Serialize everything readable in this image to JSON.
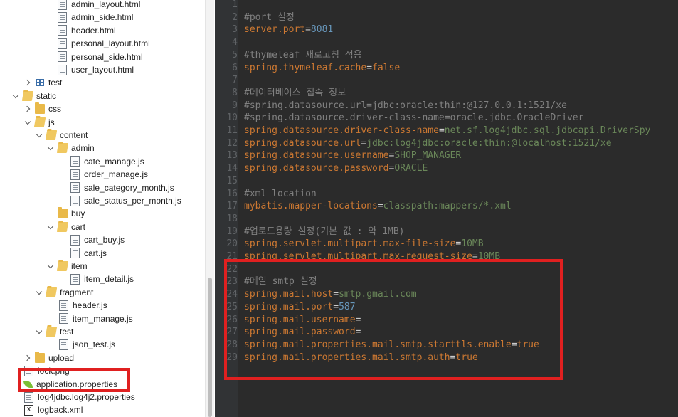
{
  "tree": {
    "items": [
      {
        "label": "admin_layout.html",
        "type": "file",
        "chev": "none",
        "indent": 64
      },
      {
        "label": "admin_side.html",
        "type": "file",
        "chev": "none",
        "indent": 64
      },
      {
        "label": "header.html",
        "type": "file",
        "chev": "none",
        "indent": 64
      },
      {
        "label": "personal_layout.html",
        "type": "file",
        "chev": "none",
        "indent": 64
      },
      {
        "label": "personal_side.html",
        "type": "file",
        "chev": "none",
        "indent": 64
      },
      {
        "label": "user_layout.html",
        "type": "file",
        "chev": "none",
        "indent": 64
      },
      {
        "label": "test",
        "type": "pkg",
        "chev": "closed",
        "indent": 34
      },
      {
        "label": "static",
        "type": "folder-open",
        "chev": "open",
        "indent": 17
      },
      {
        "label": "css",
        "type": "folder",
        "chev": "closed",
        "indent": 34
      },
      {
        "label": "js",
        "type": "folder-open",
        "chev": "open",
        "indent": 34
      },
      {
        "label": "content",
        "type": "folder-open",
        "chev": "open",
        "indent": 50
      },
      {
        "label": "admin",
        "type": "folder-open",
        "chev": "open",
        "indent": 66
      },
      {
        "label": "cate_manage.js",
        "type": "file",
        "chev": "none",
        "indent": 82
      },
      {
        "label": "order_manage.js",
        "type": "file",
        "chev": "none",
        "indent": 82
      },
      {
        "label": "sale_category_month.js",
        "type": "file",
        "chev": "none",
        "indent": 82
      },
      {
        "label": "sale_status_per_month.js",
        "type": "file",
        "chev": "none",
        "indent": 82
      },
      {
        "label": "buy",
        "type": "folder",
        "chev": "none",
        "indent": 66
      },
      {
        "label": "cart",
        "type": "folder-open",
        "chev": "open",
        "indent": 66
      },
      {
        "label": "cart_buy.js",
        "type": "file",
        "chev": "none",
        "indent": 82
      },
      {
        "label": "cart.js",
        "type": "file",
        "chev": "none",
        "indent": 82
      },
      {
        "label": "item",
        "type": "folder-open",
        "chev": "open",
        "indent": 66
      },
      {
        "label": "item_detail.js",
        "type": "file",
        "chev": "none",
        "indent": 82
      },
      {
        "label": "fragment",
        "type": "folder-open",
        "chev": "open",
        "indent": 50
      },
      {
        "label": "header.js",
        "type": "file",
        "chev": "none",
        "indent": 66
      },
      {
        "label": "item_manage.js",
        "type": "file",
        "chev": "none",
        "indent": 66
      },
      {
        "label": "test",
        "type": "folder-open",
        "chev": "open",
        "indent": 50
      },
      {
        "label": "json_test.js",
        "type": "file",
        "chev": "none",
        "indent": 66
      },
      {
        "label": "upload",
        "type": "folder",
        "chev": "closed",
        "indent": 34
      },
      {
        "label": "lock.png",
        "type": "file",
        "chev": "none",
        "indent": 17
      },
      {
        "label": "application.properties",
        "type": "leaf",
        "chev": "none",
        "indent": 17
      },
      {
        "label": "log4jdbc.log4j2.properties",
        "type": "file",
        "chev": "none",
        "indent": 17
      },
      {
        "label": "logback.xml",
        "type": "xml",
        "chev": "none",
        "indent": 17
      }
    ]
  },
  "editor": {
    "lines": [
      {
        "n": "1",
        "parts": []
      },
      {
        "n": "2",
        "parts": [
          {
            "t": "#port 설정",
            "c": "cmt"
          }
        ]
      },
      {
        "n": "3",
        "parts": [
          {
            "t": "server.port",
            "c": "key"
          },
          {
            "t": "=",
            "c": "eq"
          },
          {
            "t": "8081",
            "c": "num"
          }
        ]
      },
      {
        "n": "4",
        "parts": []
      },
      {
        "n": "5",
        "parts": [
          {
            "t": "#thymeleaf 새로고침 적용",
            "c": "cmt"
          }
        ]
      },
      {
        "n": "6",
        "parts": [
          {
            "t": "spring.thymeleaf.cache",
            "c": "key"
          },
          {
            "t": "=",
            "c": "eq"
          },
          {
            "t": "false",
            "c": "kw"
          }
        ]
      },
      {
        "n": "7",
        "parts": []
      },
      {
        "n": "8",
        "parts": [
          {
            "t": "#데이터베이스 접속 정보",
            "c": "cmt"
          }
        ]
      },
      {
        "n": "9",
        "parts": [
          {
            "t": "#spring.datasource.url=jdbc:oracle:thin:@127.0.0.1:1521/xe",
            "c": "cmt"
          }
        ]
      },
      {
        "n": "10",
        "parts": [
          {
            "t": "#spring.datasource.driver-class-name=oracle.jdbc.OracleDriver",
            "c": "cmt"
          }
        ]
      },
      {
        "n": "11",
        "parts": [
          {
            "t": "spring.datasource.driver-class-name",
            "c": "key"
          },
          {
            "t": "=",
            "c": "eq"
          },
          {
            "t": "net.sf.log4jdbc.sql.jdbcapi.DriverSpy",
            "c": "str"
          }
        ]
      },
      {
        "n": "12",
        "parts": [
          {
            "t": "spring.datasource.url",
            "c": "key"
          },
          {
            "t": "=",
            "c": "eq"
          },
          {
            "t": "jdbc:log4jdbc:oracle:thin:@localhost:1521/xe",
            "c": "str"
          }
        ]
      },
      {
        "n": "13",
        "parts": [
          {
            "t": "spring.datasource.username",
            "c": "key"
          },
          {
            "t": "=",
            "c": "eq"
          },
          {
            "t": "SHOP_MANAGER",
            "c": "str"
          }
        ]
      },
      {
        "n": "14",
        "parts": [
          {
            "t": "spring.datasource.password",
            "c": "key"
          },
          {
            "t": "=",
            "c": "eq"
          },
          {
            "t": "ORACLE",
            "c": "str"
          }
        ]
      },
      {
        "n": "15",
        "parts": []
      },
      {
        "n": "16",
        "parts": [
          {
            "t": "#xml location",
            "c": "cmt"
          }
        ]
      },
      {
        "n": "17",
        "parts": [
          {
            "t": "mybatis.mapper-locations",
            "c": "key"
          },
          {
            "t": "=",
            "c": "eq"
          },
          {
            "t": "classpath:mappers/*.xml",
            "c": "str"
          }
        ]
      },
      {
        "n": "18",
        "parts": []
      },
      {
        "n": "19",
        "parts": [
          {
            "t": "#업로드용량 설정(기본 값 : 약 1MB)",
            "c": "cmt"
          }
        ]
      },
      {
        "n": "20",
        "parts": [
          {
            "t": "spring.servlet.multipart.max-file-size",
            "c": "key"
          },
          {
            "t": "=",
            "c": "eq"
          },
          {
            "t": "10MB",
            "c": "str"
          }
        ]
      },
      {
        "n": "21",
        "parts": [
          {
            "t": "spring.servlet.multipart.max-request-size",
            "c": "key"
          },
          {
            "t": "=",
            "c": "eq"
          },
          {
            "t": "10MB",
            "c": "str"
          }
        ]
      },
      {
        "n": "22",
        "parts": []
      },
      {
        "n": "23",
        "parts": [
          {
            "t": "#메일 smtp 설정",
            "c": "cmt"
          }
        ]
      },
      {
        "n": "24",
        "parts": [
          {
            "t": "spring.mail.host",
            "c": "key"
          },
          {
            "t": "=",
            "c": "eq"
          },
          {
            "t": "smtp.gmail.com",
            "c": "str"
          }
        ]
      },
      {
        "n": "25",
        "parts": [
          {
            "t": "spring.mail.port",
            "c": "key"
          },
          {
            "t": "=",
            "c": "eq"
          },
          {
            "t": "587",
            "c": "num"
          }
        ]
      },
      {
        "n": "26",
        "parts": [
          {
            "t": "spring.mail.username",
            "c": "key"
          },
          {
            "t": "=",
            "c": "eq"
          }
        ]
      },
      {
        "n": "27",
        "parts": [
          {
            "t": "spring.mail.password",
            "c": "key"
          },
          {
            "t": "=",
            "c": "eq"
          }
        ]
      },
      {
        "n": "28",
        "parts": [
          {
            "t": "spring.mail.properties.mail.smtp.starttls.enable",
            "c": "key"
          },
          {
            "t": "=",
            "c": "eq"
          },
          {
            "t": "true",
            "c": "kw"
          }
        ]
      },
      {
        "n": "29",
        "parts": [
          {
            "t": "spring.mail.properties.mail.smtp.auth",
            "c": "key"
          },
          {
            "t": "=",
            "c": "eq"
          },
          {
            "t": "true",
            "c": "kw"
          }
        ]
      }
    ]
  },
  "colors": {
    "editor_bg": "#2b2b2b",
    "gutter_bg": "#313335",
    "line_number": "#606366",
    "comment": "#808080",
    "property_key": "#cc7832",
    "property_value": "#6a8759",
    "number": "#6897bb",
    "keyword": "#cc7832",
    "highlight_box": "#e02020"
  }
}
